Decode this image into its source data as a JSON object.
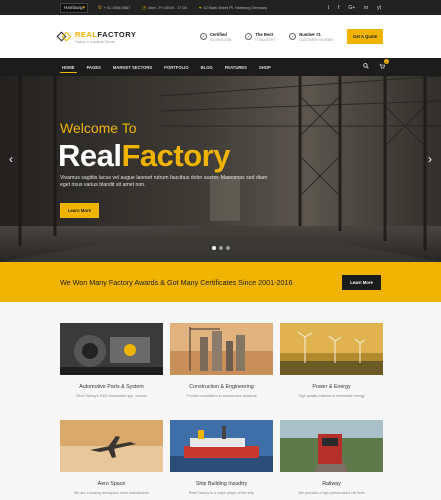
{
  "topbar": {
    "city": "Hamburg",
    "phone": "+ 01 3456 4567",
    "hours": "Mon - Fri 08:00 - 17:00",
    "address": "12 Main Street Pt. Hamburg Germany",
    "socials": [
      "t",
      "f",
      "G+",
      "in",
      "yt"
    ]
  },
  "header": {
    "logo_a": "REAL",
    "logo_b": "FACTORY",
    "tagline": "Factory & Industrial Theme",
    "features": [
      {
        "title": "Certified",
        "sub": "ISO 9001:2008"
      },
      {
        "title": "The Best",
        "sub": "IT INDUSTRY"
      },
      {
        "title": "Number #1",
        "sub": "CUSTOMER REVIEWS"
      }
    ],
    "quote_label": "Get A Quote"
  },
  "nav": {
    "items": [
      "HOME",
      "PAGES",
      "MARKET SECTORS",
      "PORTFOLIO",
      "BLOG",
      "FEATURES",
      "SHOP"
    ],
    "cart_count": "0"
  },
  "hero": {
    "welcome": "Welcome To",
    "title_white": "Real",
    "title_yellow": "Factory",
    "desc": "Vivamus sagittis lacus vel augue laoreet rutrum faucibus dolor auctor. Maecenas sed diam eget risus varius blandit sit amet non.",
    "button": "Learn More"
  },
  "awards": {
    "text": "We Won Many Factory Awards & Got Many Certificates Since 2001-2016",
    "button": "Learn More"
  },
  "services": [
    {
      "title": "Automotive Parts & System",
      "desc": "Real Factory's R&D Automotive app. vicrons"
    },
    {
      "title": "Construction & Engineering",
      "desc": "Provide competitive in construction products"
    },
    {
      "title": "Power & Energy",
      "desc": "High quality material of renewable energy"
    },
    {
      "title": "Aero Space",
      "desc": "We are a leading aerospace more manufacture"
    },
    {
      "title": "Ship Building Insudtry",
      "desc": "Real Factory is a major player of the ship"
    },
    {
      "title": "Railway",
      "desc": "We provides a high performance rail fixes"
    }
  ],
  "colors": {
    "accent": "#f0b400",
    "dark": "#1c1c1c"
  }
}
